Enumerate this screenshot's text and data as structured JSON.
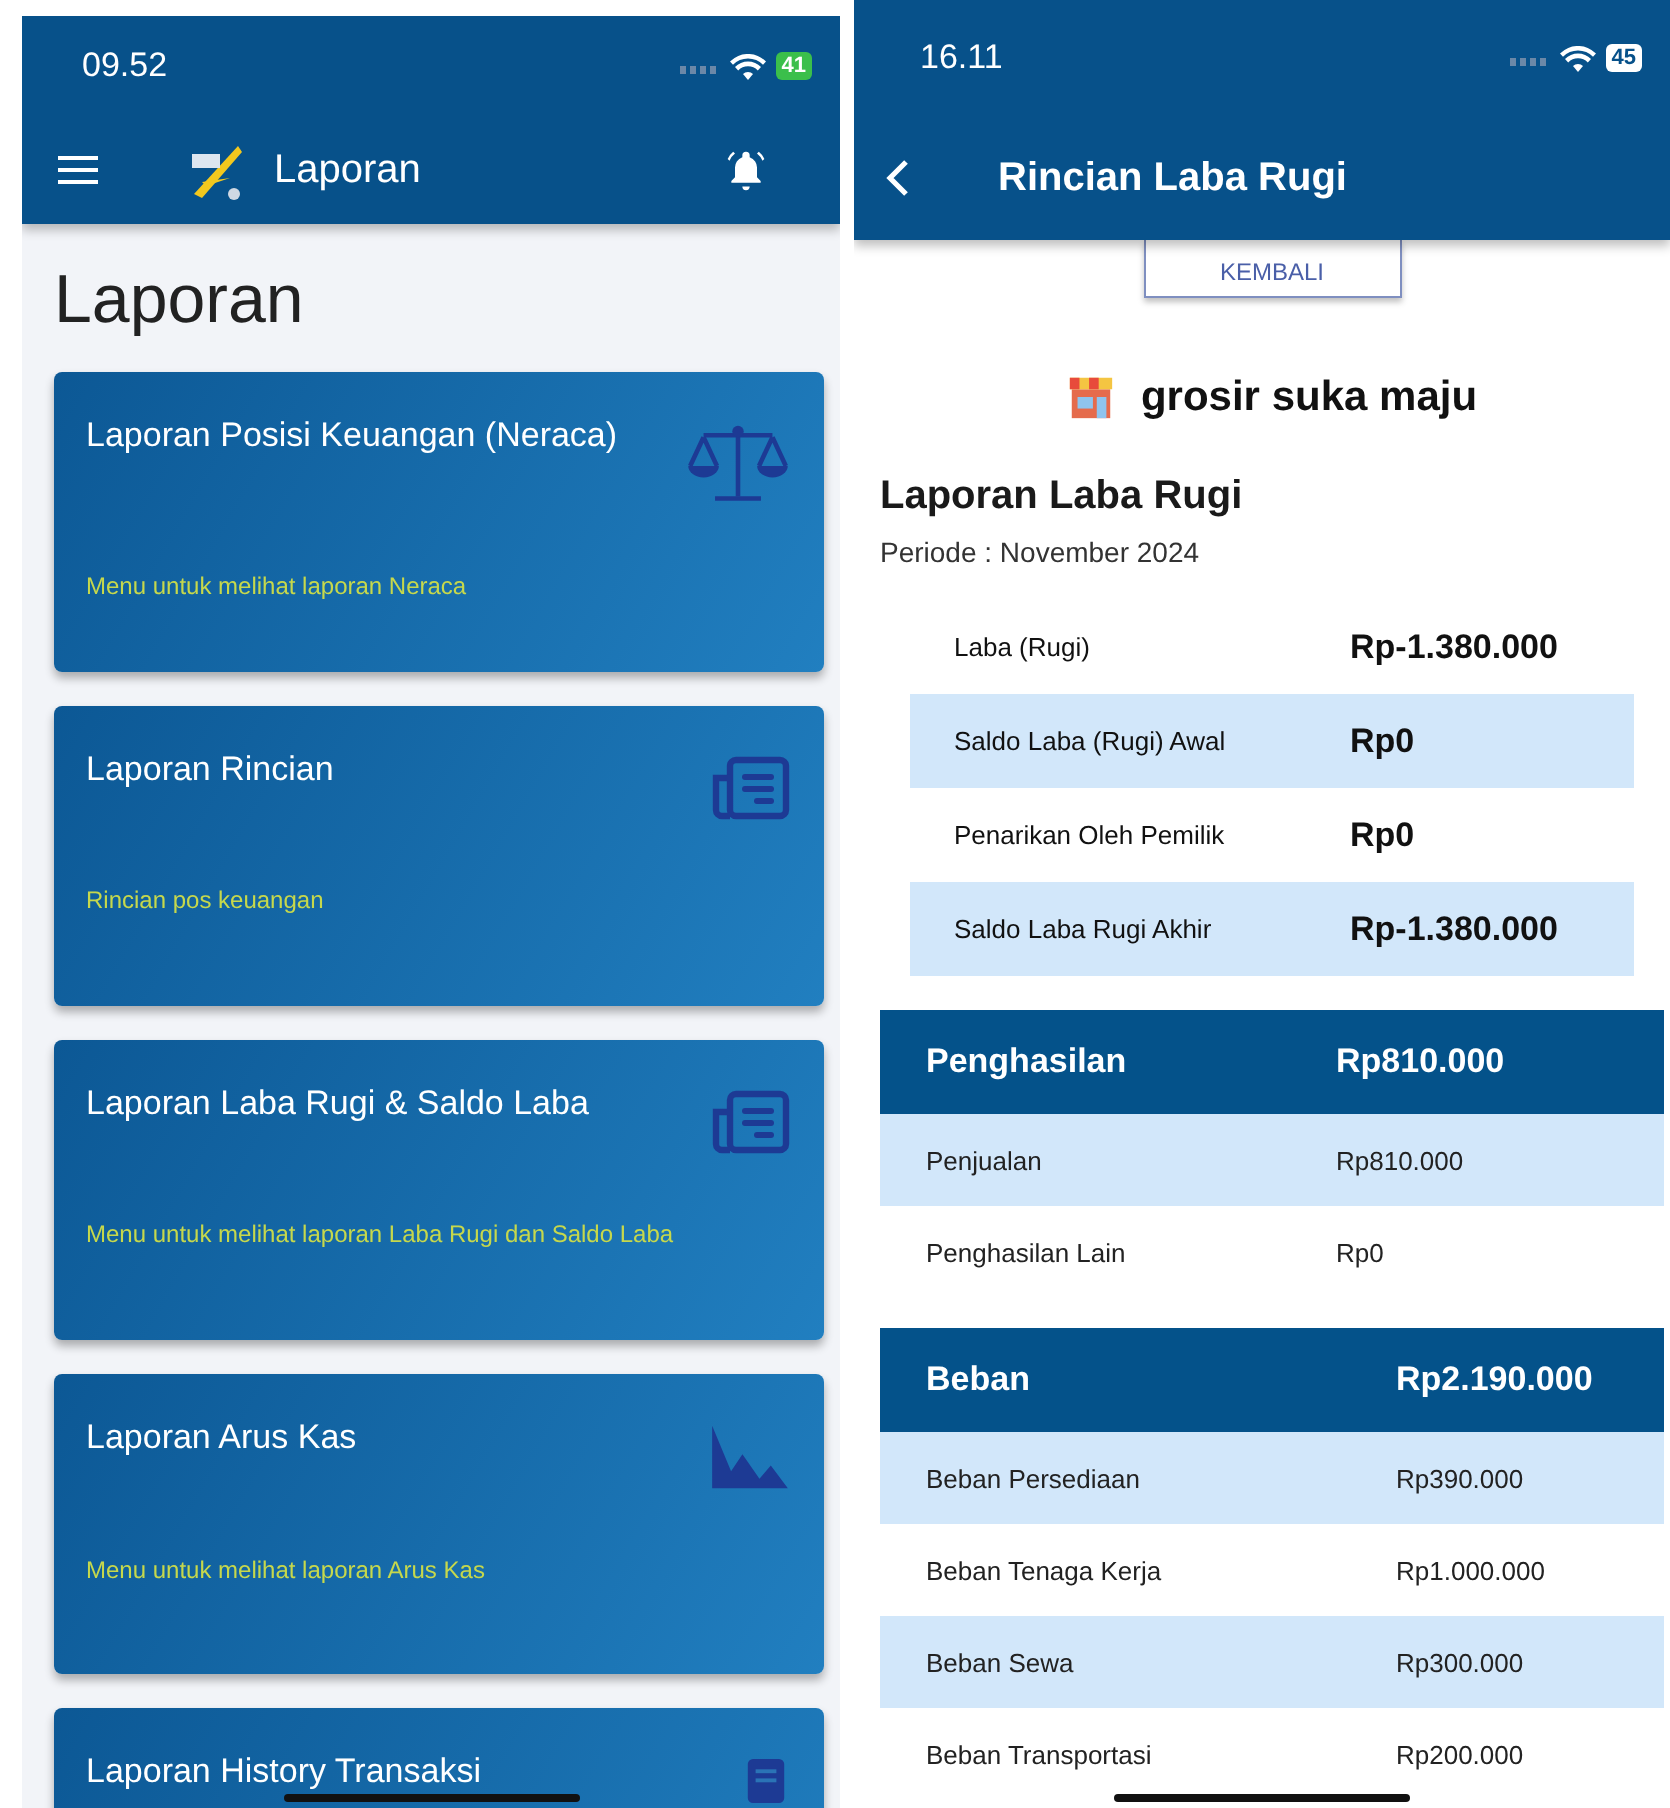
{
  "left_screen": {
    "status_bar": {
      "time": "09.52",
      "battery": "41",
      "charging": true
    },
    "app_bar": {
      "title": "Laporan"
    },
    "page_title": "Laporan",
    "cards": [
      {
        "title": "Laporan Posisi Keuangan (Neraca)",
        "description": "Menu untuk melihat laporan Neraca",
        "kind": "scale"
      },
      {
        "title": "Laporan Rincian",
        "description": "Rincian pos keuangan",
        "kind": "newspaper"
      },
      {
        "title": "Laporan Laba Rugi & Saldo Laba",
        "description": "Menu untuk melihat laporan Laba Rugi dan Saldo Laba",
        "kind": "newspaper"
      },
      {
        "title": "Laporan Arus Kas",
        "description": "Menu untuk melihat laporan Arus Kas",
        "kind": "area"
      },
      {
        "title": "Laporan History Transaksi",
        "kind": "document"
      }
    ]
  },
  "right_screen": {
    "status_bar": {
      "time": "16.11",
      "battery": "45",
      "charging": false
    },
    "app_bar": {
      "title": "Rincian Laba Rugi"
    },
    "back_button": "KEMBALI",
    "store_name": "grosir suka maju",
    "report_title": "Laporan Laba Rugi",
    "period": "Periode : November 2024",
    "summary": [
      {
        "label": "Laba (Rugi)",
        "value": "Rp-1.380.000"
      },
      {
        "label": "Saldo Laba (Rugi) Awal",
        "value": "Rp0"
      },
      {
        "label": "Penarikan Oleh Pemilik",
        "value": "Rp0"
      },
      {
        "label": "Saldo Laba Rugi Akhir",
        "value": "Rp-1.380.000"
      }
    ],
    "sections": [
      {
        "title": "Penghasilan",
        "total": "Rp810.000",
        "rows": [
          {
            "label": "Penjualan",
            "value": "Rp810.000"
          },
          {
            "label": "Penghasilan Lain",
            "value": "Rp0"
          }
        ]
      },
      {
        "title": "Beban",
        "total": "Rp2.190.000",
        "rows": [
          {
            "label": "Beban Persediaan",
            "value": "Rp390.000"
          },
          {
            "label": "Beban Tenaga Kerja",
            "value": "Rp1.000.000"
          },
          {
            "label": "Beban Sewa",
            "value": "Rp300.000"
          },
          {
            "label": "Beban Transportasi",
            "value": "Rp200.000"
          }
        ]
      }
    ]
  }
}
